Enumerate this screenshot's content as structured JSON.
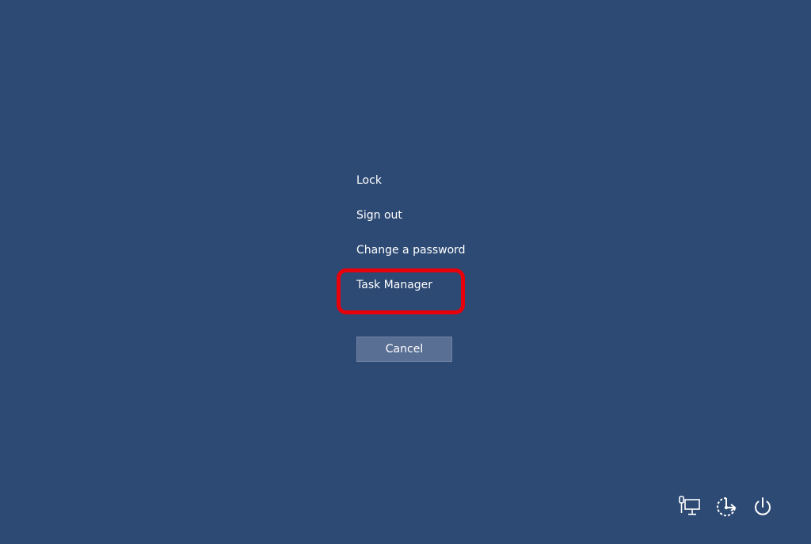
{
  "menu": {
    "items": [
      {
        "label": "Lock"
      },
      {
        "label": "Sign out"
      },
      {
        "label": "Change a password"
      },
      {
        "label": "Task Manager"
      }
    ]
  },
  "cancel": {
    "label": "Cancel"
  },
  "tray": {
    "icons": [
      "network-icon",
      "ease-of-access-icon",
      "power-icon"
    ]
  },
  "colors": {
    "background": "#2d4a74",
    "highlight": "#e8000b",
    "button": "#5a6f94"
  }
}
